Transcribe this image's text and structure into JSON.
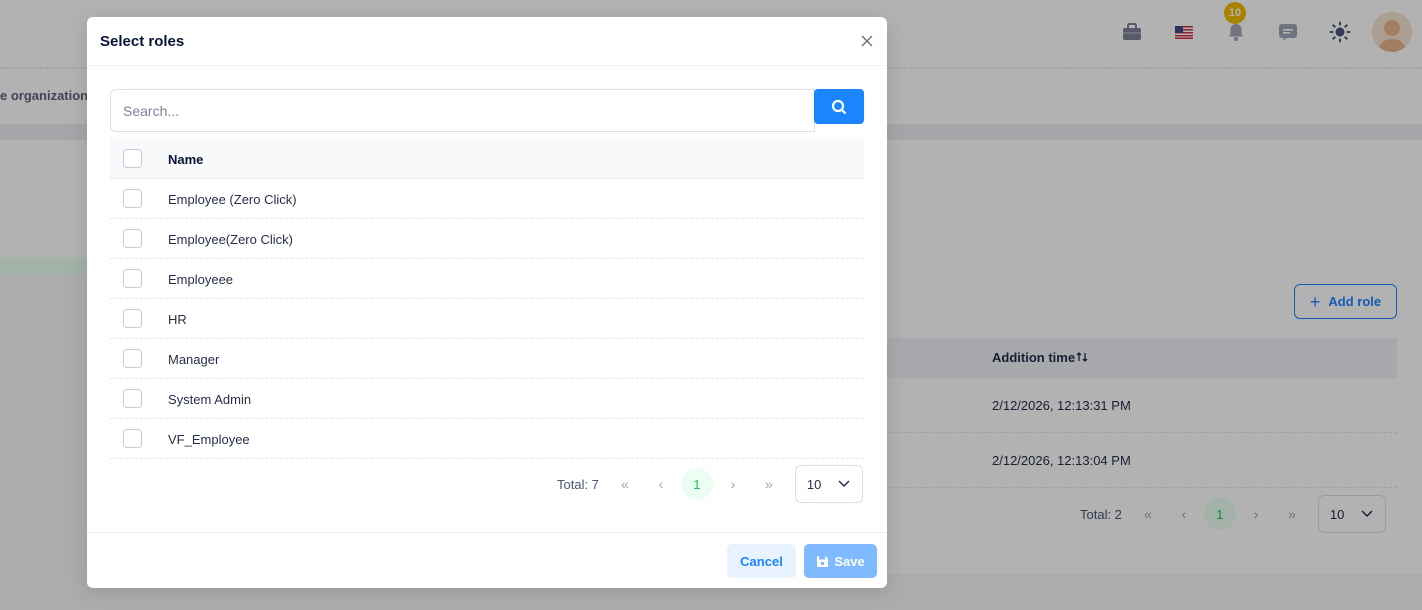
{
  "background": {
    "org_text": "e organization",
    "notification_count": "10",
    "add_role_label": "Add role",
    "table": {
      "column": "Addition time",
      "rows": [
        "2/12/2026, 12:13:31 PM",
        "2/12/2026, 12:13:04 PM"
      ]
    },
    "pager": {
      "total": "Total: 2",
      "page": "1",
      "page_size": "10"
    }
  },
  "modal": {
    "title": "Select roles",
    "search_placeholder": "Search...",
    "column_name": "Name",
    "roles": [
      "Employee (Zero Click)",
      "Employee(Zero Click)",
      "Employeee",
      "HR",
      "Manager",
      "System Admin",
      "VF_Employee"
    ],
    "pager": {
      "total": "Total: 7",
      "page": "1",
      "page_size": "10"
    },
    "cancel_label": "Cancel",
    "save_label": "Save"
  },
  "colors": {
    "primary": "#1b84ff",
    "primary_light": "#e9f3ff",
    "save_disabled": "#7fb9ff",
    "badge": "#f1bc00",
    "active_page": "#17c653"
  }
}
